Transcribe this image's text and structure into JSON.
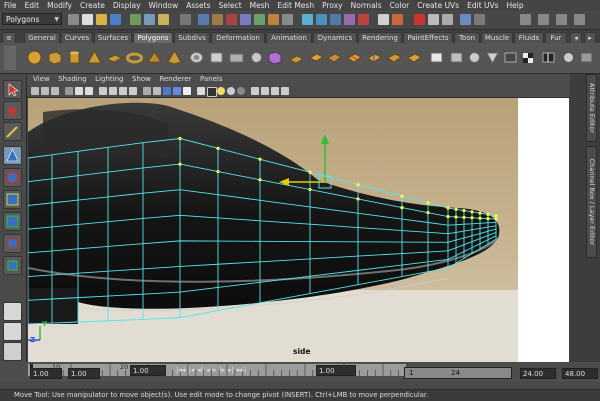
{
  "menubar": [
    "File",
    "Edit",
    "Modify",
    "Create",
    "Display",
    "Window",
    "Assets",
    "Select",
    "Mesh",
    "Edit Mesh",
    "Proxy",
    "Normals",
    "Color",
    "Create UVs",
    "Edit UVs",
    "Help"
  ],
  "status_line": {
    "mode": "Polygons"
  },
  "shelf": {
    "tabs": [
      "General",
      "Curves",
      "Surfaces",
      "Polygons",
      "Subdivs",
      "Deformation",
      "Animation",
      "Dynamics",
      "Rendering",
      "PaintEffects",
      "Toon",
      "Muscle",
      "Fluids",
      "Fur"
    ],
    "active_tab": "Polygons"
  },
  "panel": {
    "menus": [
      "View",
      "Shading",
      "Lighting",
      "Show",
      "Renderer",
      "Panels"
    ],
    "camera_label": "side",
    "axis_z": "Z",
    "axis_y": "Y"
  },
  "side_tabs": [
    "Attribute Editor",
    "Channel Box / Layer Editor"
  ],
  "timeline": {
    "ticks": [
      "10",
      "20"
    ],
    "current_frame": "1.00"
  },
  "range": {
    "start_time": "1.00",
    "playback_start": "1.00",
    "range_start": "1.00",
    "range_field_start": "1",
    "range_field_end": "24",
    "playback_end": "24.00",
    "end_time": "48.00"
  },
  "help_line": "Move Tool: Use manipulator to move object(s). Use edit mode to change pivot (INSERT).  Ctrl+LMB to move perpendicular.",
  "colors": {
    "wire": "#54e5ea",
    "vertex": "#ffff40",
    "manip_x": "#e0d000",
    "manip_y": "#30c030",
    "highlight": "#7a98b8"
  }
}
